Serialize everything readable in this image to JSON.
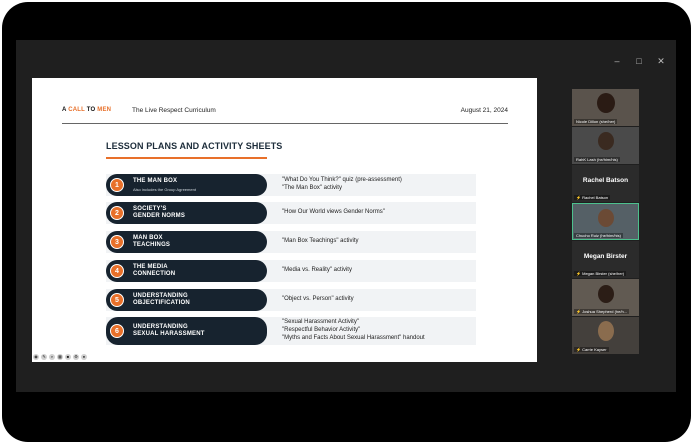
{
  "window_controls": [
    "–",
    "□",
    "✕"
  ],
  "slide": {
    "logo": {
      "a": "A",
      "call": "CALL",
      "to": "TO",
      "men": "MEN"
    },
    "curriculum": "The Live Respect Curriculum",
    "date": "August 21, 2024",
    "title": "LESSON PLANS AND ACTIVITY SHEETS",
    "lessons": [
      {
        "num": "1",
        "title_line1": "THE MAN BOX",
        "title_line2": "",
        "subtitle": "Also includes the Group Agreement",
        "activities": [
          "\"What Do You Think?\" quiz (pre-assessment)",
          "\"The Man Box\" activity"
        ]
      },
      {
        "num": "2",
        "title_line1": "SOCIETY'S",
        "title_line2": "GENDER NORMS",
        "subtitle": "",
        "activities": [
          "\"How Our World views Gender Norms\""
        ]
      },
      {
        "num": "3",
        "title_line1": "MAN BOX",
        "title_line2": "TEACHINGS",
        "subtitle": "",
        "activities": [
          "\"Man Box Teachings\" activity"
        ]
      },
      {
        "num": "4",
        "title_line1": "THE MEDIA",
        "title_line2": "CONNECTION",
        "subtitle": "",
        "activities": [
          "\"Media vs. Reality\" activity"
        ]
      },
      {
        "num": "5",
        "title_line1": "UNDERSTANDING",
        "title_line2": "OBJECTIFICATION",
        "subtitle": "",
        "activities": [
          "\"Object vs. Person\" activity"
        ]
      },
      {
        "num": "6",
        "title_line1": "UNDERSTANDING",
        "title_line2": "SEXUAL HARASSMENT",
        "subtitle": "",
        "activities": [
          "\"Sexual Harassment Activity\"",
          "\"Respectful Behavior Activity\"",
          "\"Myths and Facts About Sexual Harassment\" handout"
        ]
      }
    ]
  },
  "participants": [
    {
      "type": "video",
      "caption": "Nicole Dillon (she/her)",
      "muted": false
    },
    {
      "type": "video",
      "caption": "RahK Lash (he/him/his)",
      "muted": false
    },
    {
      "type": "name",
      "big_name": "Rachel Batson",
      "caption": "Rachel Batson",
      "muted": true
    },
    {
      "type": "video",
      "caption": "Chucho Ruiz (he/him/his)",
      "muted": false,
      "active": true
    },
    {
      "type": "name",
      "big_name": "Megan Birster",
      "caption": "Megan Birster (she/her)",
      "muted": true
    },
    {
      "type": "video",
      "caption": "Joshua Shepherd (he/h...",
      "muted": true
    },
    {
      "type": "video",
      "caption": "Carrie Kayser",
      "muted": true
    }
  ],
  "colors": {
    "accent": "#e8702a",
    "navy": "#17232f",
    "active_border": "#4cc08d"
  }
}
